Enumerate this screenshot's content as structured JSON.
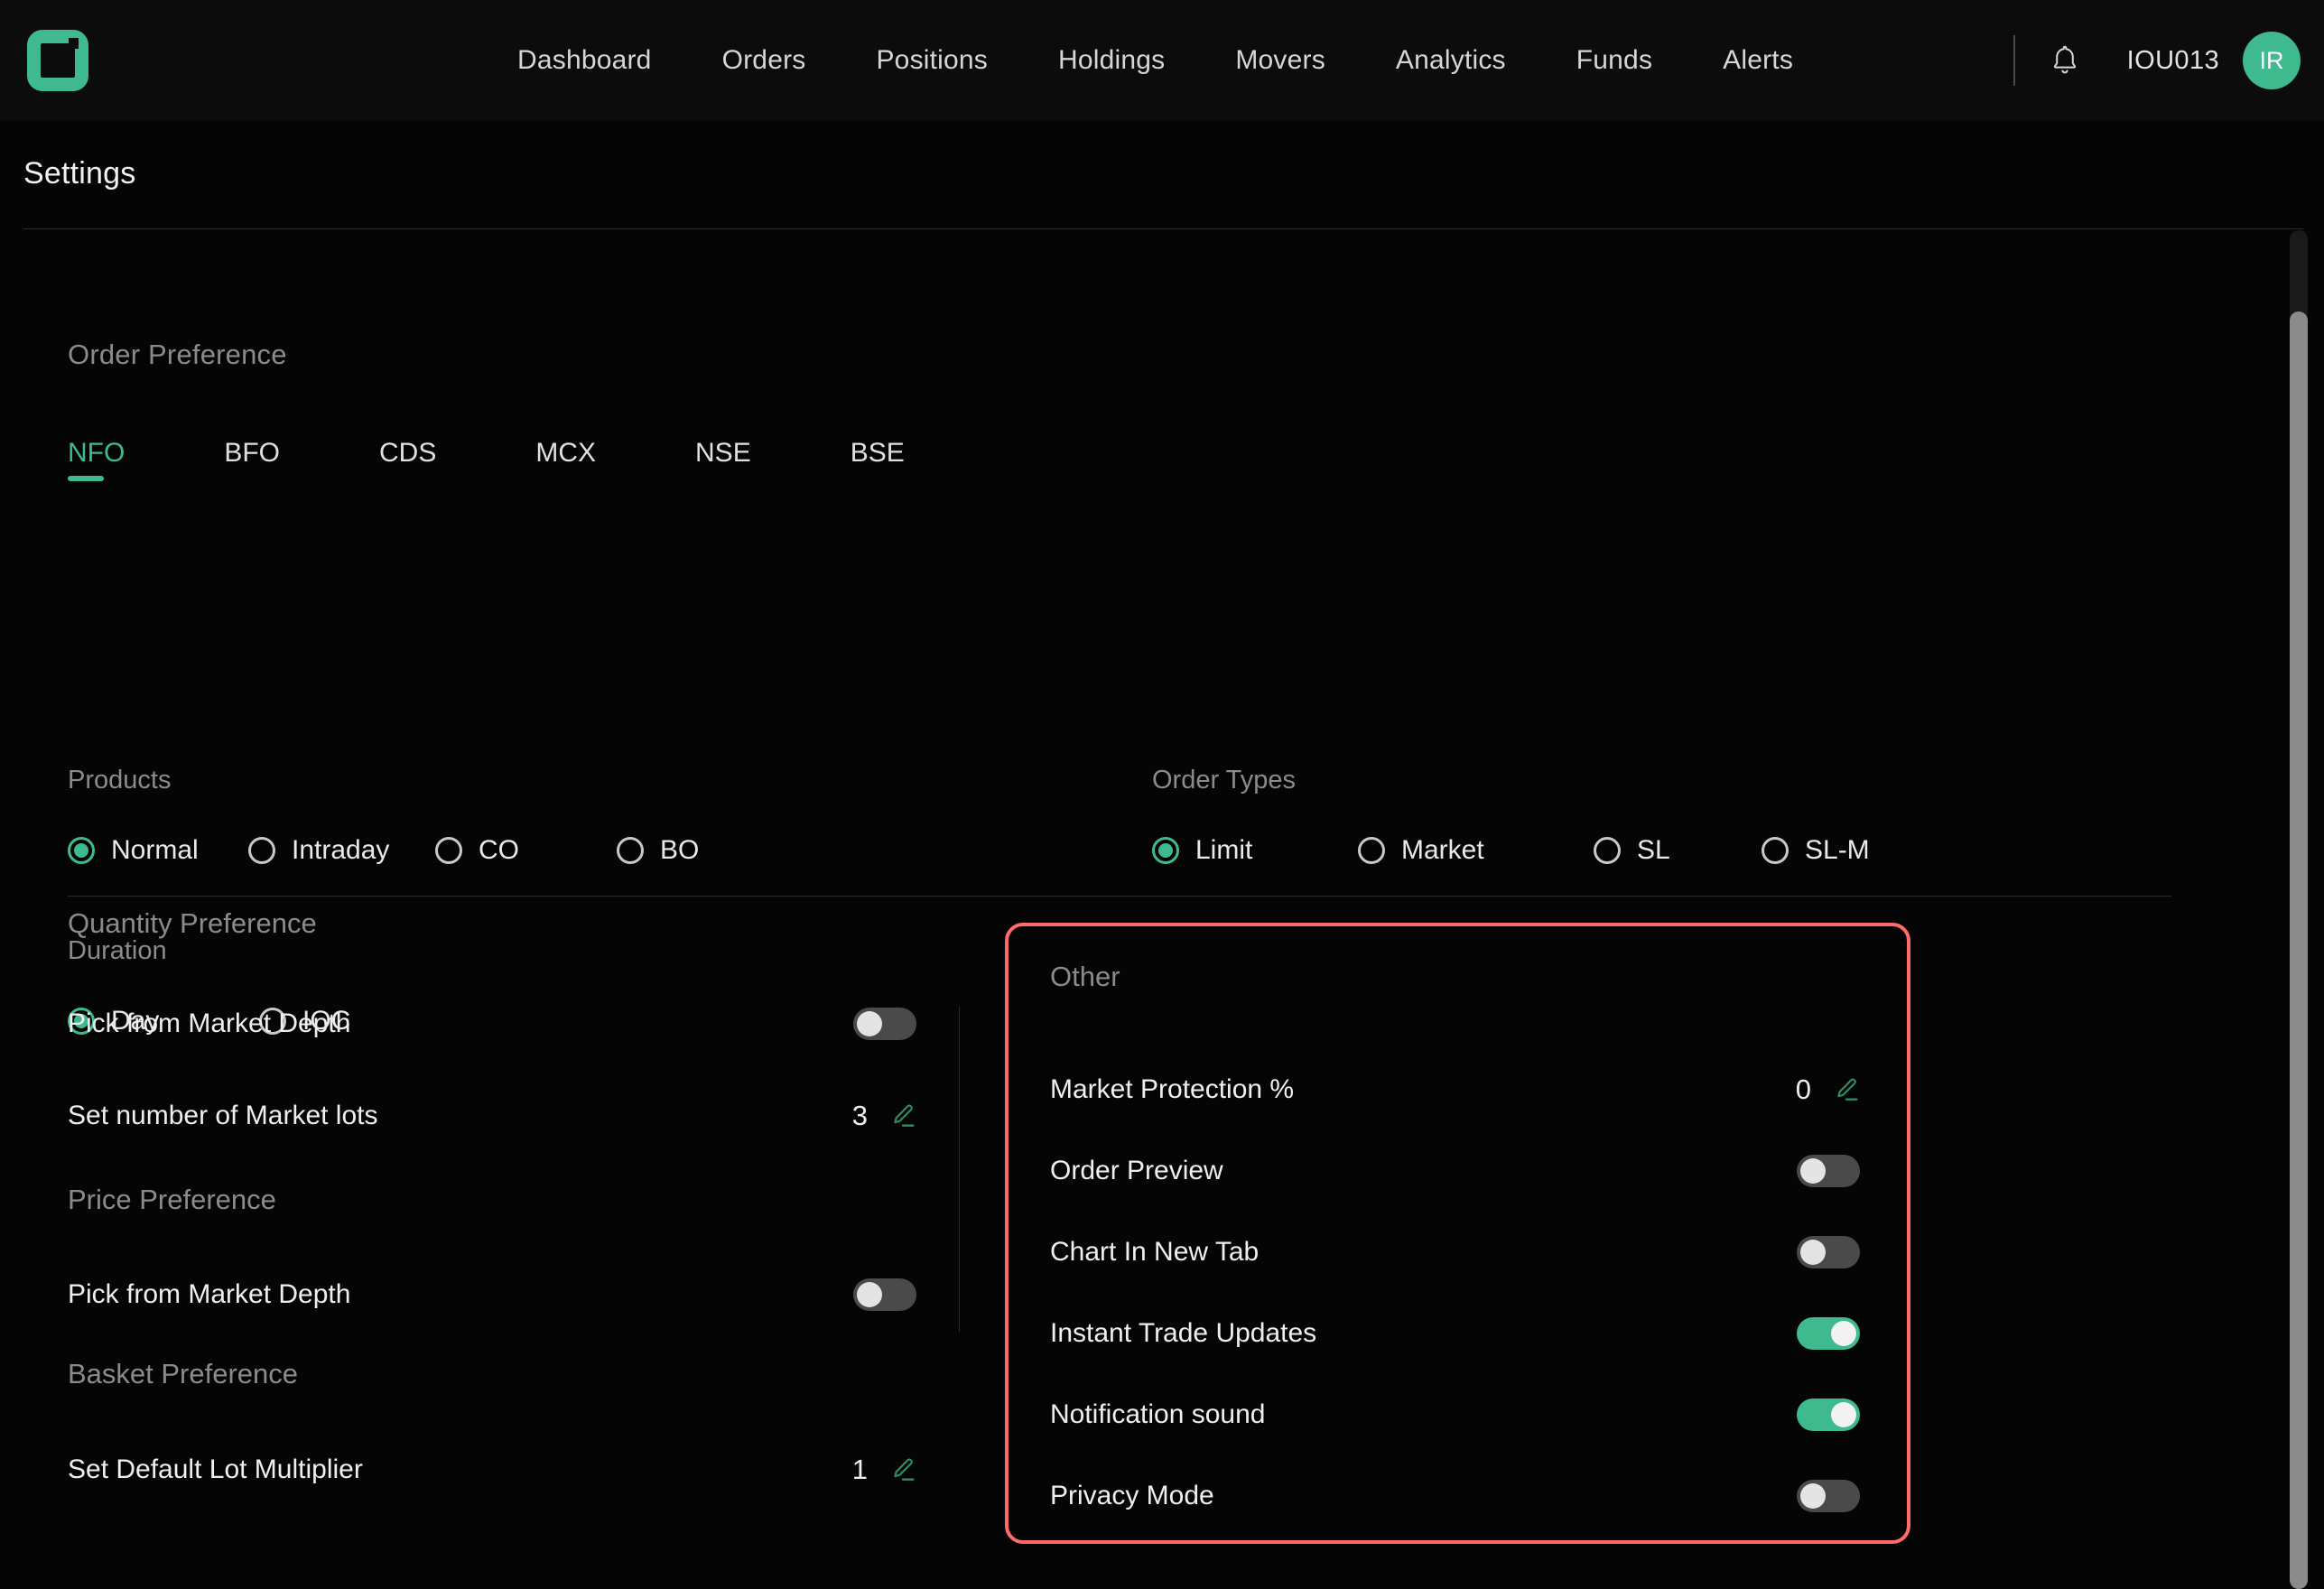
{
  "theme": {
    "accent": "#3fba8f",
    "highlight_border": "#ff6b6b",
    "background": "#050505",
    "topbar_background": "#0b0c0b"
  },
  "topbar": {
    "logo_name": "app-logo",
    "nav_items": [
      {
        "label": "Dashboard"
      },
      {
        "label": "Orders"
      },
      {
        "label": "Positions"
      },
      {
        "label": "Holdings"
      },
      {
        "label": "Movers"
      },
      {
        "label": "Analytics"
      },
      {
        "label": "Funds"
      },
      {
        "label": "Alerts"
      }
    ],
    "notification_icon": "bell-icon",
    "account_id": "IOU013",
    "avatar_initials": "IR"
  },
  "page": {
    "title": "Settings"
  },
  "order_preference": {
    "label": "Order Preference",
    "exchange_tabs": [
      {
        "label": "NFO",
        "active": true
      },
      {
        "label": "BFO",
        "active": false
      },
      {
        "label": "CDS",
        "active": false
      },
      {
        "label": "MCX",
        "active": false
      },
      {
        "label": "NSE",
        "active": false
      },
      {
        "label": "BSE",
        "active": false
      }
    ],
    "products": {
      "title": "Products",
      "options": [
        {
          "label": "Normal",
          "selected": true
        },
        {
          "label": "Intraday",
          "selected": false
        },
        {
          "label": "CO",
          "selected": false
        },
        {
          "label": "BO",
          "selected": false
        }
      ]
    },
    "order_types": {
      "title": "Order Types",
      "options": [
        {
          "label": "Limit",
          "selected": true
        },
        {
          "label": "Market",
          "selected": false
        },
        {
          "label": "SL",
          "selected": false
        },
        {
          "label": "SL-M",
          "selected": false
        }
      ]
    },
    "duration": {
      "title": "Duration",
      "options": [
        {
          "label": "Day",
          "selected": true
        },
        {
          "label": "IOC",
          "selected": false
        }
      ]
    }
  },
  "quantity_preference": {
    "title": "Quantity Preference",
    "rows": [
      {
        "label": "Pick from Market Depth",
        "control": "toggle",
        "value": "off"
      },
      {
        "label": "Set number of Market lots",
        "control": "value-edit",
        "value": "3",
        "icon": "pencil-icon"
      }
    ]
  },
  "price_preference": {
    "title": "Price Preference",
    "rows": [
      {
        "label": "Pick from Market Depth",
        "control": "toggle",
        "value": "off"
      }
    ]
  },
  "basket_preference": {
    "title": "Basket Preference",
    "rows": [
      {
        "label": "Set Default Lot Multiplier",
        "control": "value-edit",
        "value": "1",
        "icon": "pencil-icon"
      }
    ]
  },
  "other": {
    "title": "Other",
    "highlighted": true,
    "rows": [
      {
        "label": "Market Protection %",
        "control": "value-edit",
        "value": "0",
        "icon": "pencil-icon"
      },
      {
        "label": "Order Preview",
        "control": "toggle",
        "value": "off"
      },
      {
        "label": "Chart In New Tab",
        "control": "toggle",
        "value": "off"
      },
      {
        "label": "Instant Trade Updates",
        "control": "toggle",
        "value": "on"
      },
      {
        "label": "Notification sound",
        "control": "toggle",
        "value": "on"
      },
      {
        "label": "Privacy Mode",
        "control": "toggle",
        "value": "off"
      }
    ]
  }
}
